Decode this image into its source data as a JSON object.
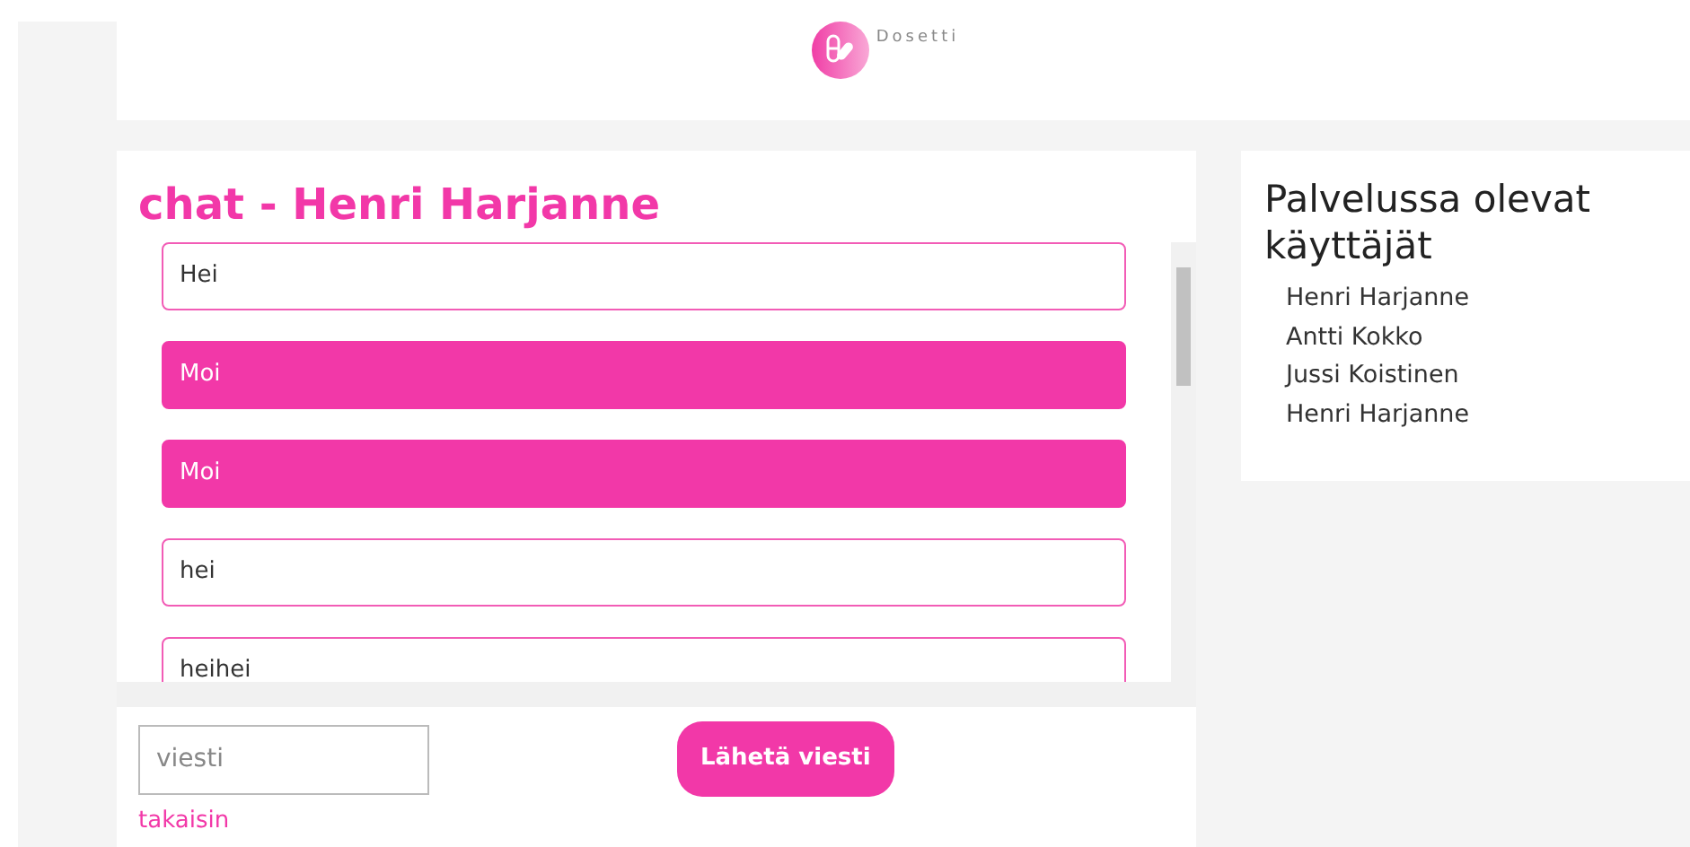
{
  "header": {
    "logo_text": "Dosetti"
  },
  "chat": {
    "title": "chat - Henri Harjanne",
    "messages": [
      {
        "text": "Hei",
        "kind": "received"
      },
      {
        "text": "Moi",
        "kind": "sent"
      },
      {
        "text": "Moi",
        "kind": "sent"
      },
      {
        "text": "hei",
        "kind": "received"
      },
      {
        "text": "heihei",
        "kind": "received"
      }
    ],
    "input": {
      "placeholder": "viesti"
    },
    "send_button": "Lähetä viesti",
    "back_link": "takaisin"
  },
  "users_panel": {
    "title": "Palvelussa olevat käyttäjät",
    "users": [
      "Henri Harjanne",
      "Antti Kokko",
      "Jussi Koistinen",
      "Henri Harjanne"
    ]
  }
}
